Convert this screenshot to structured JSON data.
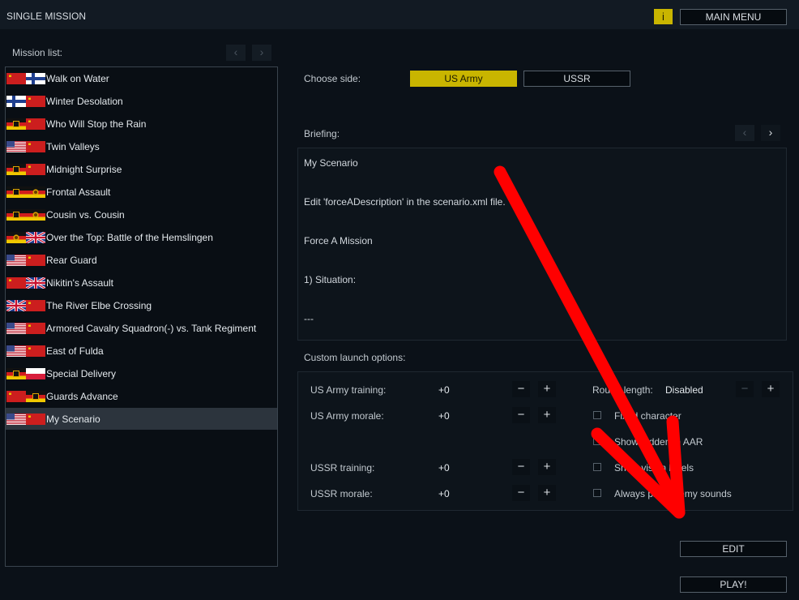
{
  "header": {
    "title": "SINGLE MISSION",
    "info_label": "i",
    "main_menu_label": "MAIN MENU"
  },
  "mission_list": {
    "label": "Mission list:",
    "items": [
      {
        "name": "Walk on Water",
        "flags": [
          "ussr-flag",
          "finland-flag"
        ]
      },
      {
        "name": "Winter Desolation",
        "flags": [
          "finland-flag",
          "ussr-flag"
        ]
      },
      {
        "name": "Who Will Stop the Rain",
        "flags": [
          "west-germany-flag",
          "ussr-flag"
        ]
      },
      {
        "name": "Twin Valleys",
        "flags": [
          "usa-flag",
          "ussr-flag"
        ]
      },
      {
        "name": "Midnight Surprise",
        "flags": [
          "west-germany-flag",
          "ussr-flag"
        ]
      },
      {
        "name": "Frontal Assault",
        "flags": [
          "west-germany-flag",
          "east-germany-flag"
        ]
      },
      {
        "name": "Cousin vs. Cousin",
        "flags": [
          "west-germany-flag",
          "east-germany-flag"
        ]
      },
      {
        "name": "Over the Top: Battle of the Hemslingen",
        "flags": [
          "east-germany-flag",
          "uk-flag"
        ]
      },
      {
        "name": "Rear Guard",
        "flags": [
          "usa-flag",
          "ussr-flag"
        ]
      },
      {
        "name": "Nikitin's Assault",
        "flags": [
          "ussr-flag",
          "uk-flag"
        ]
      },
      {
        "name": "The River Elbe Crossing",
        "flags": [
          "uk-flag",
          "ussr-flag"
        ]
      },
      {
        "name": "Armored Cavalry Squadron(-) vs. Tank Regiment",
        "flags": [
          "usa-flag",
          "ussr-flag"
        ]
      },
      {
        "name": "East of Fulda",
        "flags": [
          "usa-flag",
          "ussr-flag"
        ]
      },
      {
        "name": "Special Delivery",
        "flags": [
          "west-germany-flag",
          "poland-flag"
        ]
      },
      {
        "name": "Guards Advance",
        "flags": [
          "ussr-flag",
          "west-germany-flag"
        ]
      },
      {
        "name": "My Scenario",
        "flags": [
          "usa-flag",
          "ussr-flag"
        ],
        "selected": true
      }
    ]
  },
  "side": {
    "label": "Choose side:",
    "options": [
      "US Army",
      "USSR"
    ],
    "selected": "US Army"
  },
  "briefing": {
    "label": "Briefing:",
    "lines": [
      "My Scenario",
      "Edit 'forceADescription' in the scenario.xml file.",
      "Force A Mission",
      "1) Situation:",
      "---"
    ]
  },
  "custom_options": {
    "label": "Custom launch options:",
    "stats": [
      {
        "label": "US Army training:",
        "value": "+0"
      },
      {
        "label": "US Army morale:",
        "value": "+0"
      },
      {
        "label": "USSR training:",
        "value": "+0"
      },
      {
        "label": "USSR morale:",
        "value": "+0"
      }
    ],
    "round_length": {
      "label": "Round length:",
      "value": "Disabled"
    },
    "checkboxes": [
      "Fixed character",
      "Show hidden in AAR",
      "Show vision levels",
      "Always play enemy sounds"
    ],
    "minus_symbol": "−",
    "plus_symbol": "+"
  },
  "actions": {
    "edit_label": "EDIT",
    "play_label": "PLAY!"
  },
  "nav": {
    "prev_symbol": "‹",
    "next_symbol": "›"
  },
  "colors": {
    "accent": "#c9b500",
    "background": "#0b1118",
    "selected_row": "#2c343d",
    "annotation_arrow": "#ff0000"
  }
}
